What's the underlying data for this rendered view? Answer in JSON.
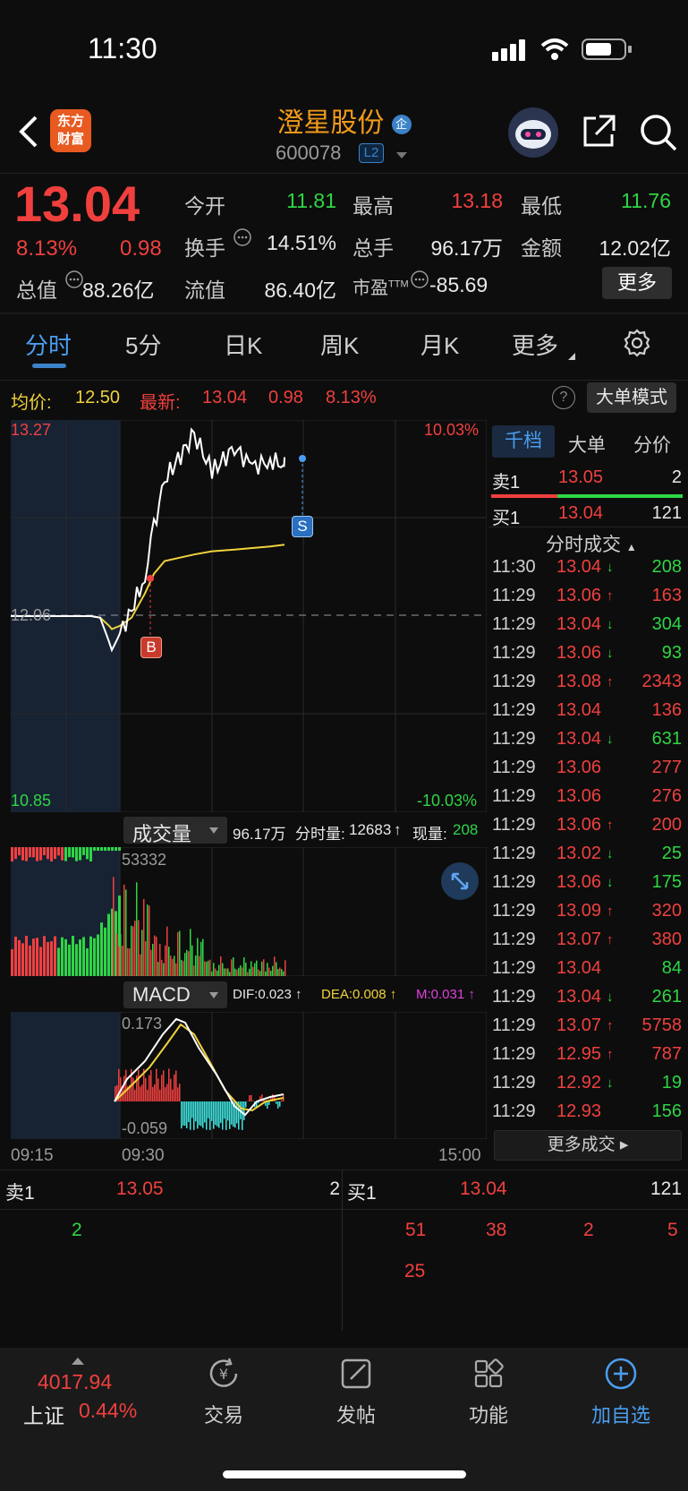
{
  "status": {
    "time": "11:30"
  },
  "header": {
    "logo_text_line1": "东方",
    "logo_text_line2": "财富",
    "stock_name": "澄星股份",
    "name_badge": "企",
    "stock_code": "600078",
    "level_badge": "L2"
  },
  "quote": {
    "price": "13.04",
    "change_pct": "8.13%",
    "change_amt": "0.98",
    "open_label": "今开",
    "open_val": "11.81",
    "high_label": "最高",
    "high_val": "13.18",
    "low_label": "最低",
    "low_val": "11.76",
    "turnover_label": "换手",
    "turnover_val": "14.51%",
    "volume_label": "总手",
    "volume_val": "96.17万",
    "amount_label": "金额",
    "amount_val": "12.02亿",
    "mktcap_label": "总值",
    "mktcap_val": "88.26亿",
    "float_label": "流值",
    "float_val": "86.40亿",
    "pe_label": "市盈",
    "pe_sup": "TTM",
    "pe_val": "-85.69",
    "more_button": "更多"
  },
  "tabs": [
    "分时",
    "5分",
    "日K",
    "周K",
    "月K",
    "更多"
  ],
  "info_bar": {
    "avg_label": "均价:",
    "avg_val": "12.50",
    "latest_label": "最新:",
    "latest_val": "13.04",
    "latest_chg": "0.98",
    "latest_pct": "8.13%",
    "help_icon": "?",
    "mode_button": "大单模式"
  },
  "price_chart": {
    "top_left": "13.27",
    "top_right": "10.03%",
    "mid_left": "12.06",
    "bottom_left": "10.85",
    "bottom_right": "-10.03%",
    "buy_marker": "B",
    "sell_marker": "S"
  },
  "volume_panel": {
    "selector": "成交量",
    "total": "96.17万",
    "minute_label": "分时量:",
    "minute_val": "12683",
    "now_label": "现量:",
    "now_val": "208",
    "max_label": "53332"
  },
  "macd_panel": {
    "selector": "MACD",
    "dif": "DIF:0.023",
    "dea": "DEA:0.008",
    "m": "M:0.031",
    "top_label": "0.173",
    "bottom_label": "-0.059"
  },
  "time_axis": {
    "start": "09:15",
    "mid": "09:30",
    "end": "15:00"
  },
  "side_tabs": [
    "千档",
    "大单",
    "分价"
  ],
  "order_book": {
    "sell_label": "卖1",
    "sell_price": "13.05",
    "sell_qty": "2",
    "buy_label": "买1",
    "buy_price": "13.04",
    "buy_qty": "121"
  },
  "ticks_title": "分时成交",
  "ticks": [
    {
      "time": "11:30",
      "price": "13.04",
      "dir": "↓",
      "vol": "208",
      "pc": "red",
      "vc": "green"
    },
    {
      "time": "11:29",
      "price": "13.06",
      "dir": "↑",
      "vol": "163",
      "pc": "red",
      "vc": "red"
    },
    {
      "time": "11:29",
      "price": "13.04",
      "dir": "↓",
      "vol": "304",
      "pc": "red",
      "vc": "green"
    },
    {
      "time": "11:29",
      "price": "13.06",
      "dir": "↓",
      "vol": "93",
      "pc": "red",
      "vc": "green"
    },
    {
      "time": "11:29",
      "price": "13.08",
      "dir": "↑",
      "vol": "2343",
      "pc": "red",
      "vc": "red"
    },
    {
      "time": "11:29",
      "price": "13.04",
      "dir": "",
      "vol": "136",
      "pc": "red",
      "vc": "red"
    },
    {
      "time": "11:29",
      "price": "13.04",
      "dir": "↓",
      "vol": "631",
      "pc": "red",
      "vc": "green"
    },
    {
      "time": "11:29",
      "price": "13.06",
      "dir": "",
      "vol": "277",
      "pc": "red",
      "vc": "red"
    },
    {
      "time": "11:29",
      "price": "13.06",
      "dir": "",
      "vol": "276",
      "pc": "red",
      "vc": "red"
    },
    {
      "time": "11:29",
      "price": "13.06",
      "dir": "↑",
      "vol": "200",
      "pc": "red",
      "vc": "red"
    },
    {
      "time": "11:29",
      "price": "13.02",
      "dir": "↓",
      "vol": "25",
      "pc": "red",
      "vc": "green"
    },
    {
      "time": "11:29",
      "price": "13.06",
      "dir": "↓",
      "vol": "175",
      "pc": "red",
      "vc": "green"
    },
    {
      "time": "11:29",
      "price": "13.09",
      "dir": "↑",
      "vol": "320",
      "pc": "red",
      "vc": "red"
    },
    {
      "time": "11:29",
      "price": "13.07",
      "dir": "↑",
      "vol": "380",
      "pc": "red",
      "vc": "red"
    },
    {
      "time": "11:29",
      "price": "13.04",
      "dir": "",
      "vol": "84",
      "pc": "red",
      "vc": "green"
    },
    {
      "time": "11:29",
      "price": "13.04",
      "dir": "↓",
      "vol": "261",
      "pc": "red",
      "vc": "green"
    },
    {
      "time": "11:29",
      "price": "13.07",
      "dir": "↑",
      "vol": "5758",
      "pc": "red",
      "vc": "red"
    },
    {
      "time": "11:29",
      "price": "12.95",
      "dir": "↑",
      "vol": "787",
      "pc": "red",
      "vc": "red"
    },
    {
      "time": "11:29",
      "price": "12.92",
      "dir": "↓",
      "vol": "19",
      "pc": "red",
      "vc": "green"
    },
    {
      "time": "11:29",
      "price": "12.93",
      "dir": "",
      "vol": "156",
      "pc": "red",
      "vc": "green"
    }
  ],
  "more_ticks_button": "更多成交",
  "queue": {
    "sell_label": "卖1",
    "sell_price": "13.05",
    "sell_qty": "2",
    "buy_label": "买1",
    "buy_price": "13.04",
    "buy_qty": "121",
    "sell_orders": [
      "2"
    ],
    "buy_orders_row1": [
      "51",
      "38",
      "2",
      "5"
    ],
    "buy_orders_row2": [
      "25"
    ]
  },
  "bottom_nav": {
    "index_val": "4017.94",
    "index_name": "上证",
    "index_pct": "0.44%",
    "trade": "交易",
    "post": "发帖",
    "func": "功能",
    "add": "加自选"
  },
  "chart_data": {
    "type": "line",
    "series": [
      {
        "values": [
          12.06,
          12.06,
          12.06,
          12.05,
          11.9,
          11.85,
          11.95,
          12.1,
          12.3,
          12.6,
          12.9,
          13.18,
          12.95,
          13.1,
          12.98,
          13.02,
          13.0,
          13.04
        ]
      },
      {
        "values": [
          12.06,
          12.06,
          12.06,
          12.05,
          12.0,
          11.98,
          12.0,
          12.05,
          12.2,
          12.32,
          12.4,
          12.44,
          12.46,
          12.47,
          12.48,
          12.49,
          12.5,
          12.5
        ]
      }
    ],
    "ylim": [
      10.85,
      13.27
    ],
    "accent_colors": {
      "up": "#f0403e",
      "down": "#2fd545",
      "avg": "#f0d23c",
      "blue": "#3b82c8"
    }
  }
}
